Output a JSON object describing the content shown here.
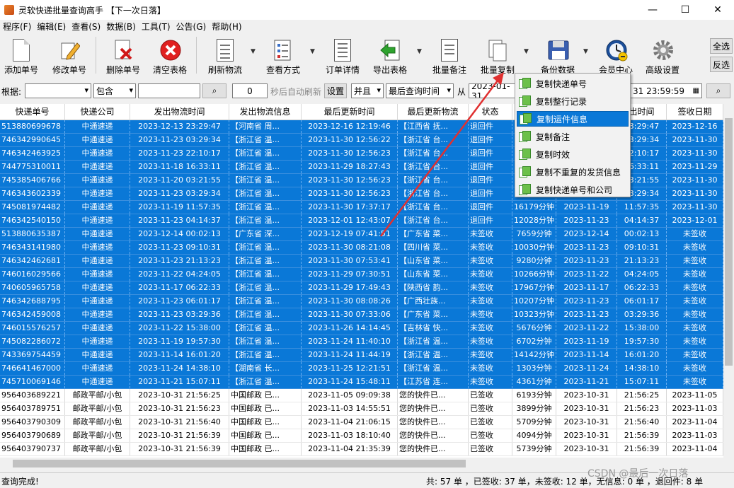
{
  "window": {
    "title": "灵软快递批量查询高手 【下一次日落】",
    "minimize": "—",
    "maximize": "☐",
    "close": "✕"
  },
  "menu": [
    "程序(F)",
    "编辑(E)",
    "查看(S)",
    "数据(B)",
    "工具(T)",
    "公告(G)",
    "帮助(H)"
  ],
  "toolbar": {
    "add": "添加单号",
    "edit": "修改单号",
    "delete": "删除单号",
    "clear": "清空表格",
    "refresh": "刷新物流",
    "view": "查看方式",
    "detail": "订单详情",
    "export": "导出表格",
    "note": "批量备注",
    "copy": "批量复制",
    "backup": "备份数据",
    "member": "会员中心",
    "advanced": "高级设置",
    "select_all": "全选",
    "invert": "反选"
  },
  "filter": {
    "label_basis": "根据:",
    "basis_value": "",
    "match": "包含",
    "keyword": "",
    "seconds": "0",
    "auto_refresh": "秒后自动刷新",
    "set": "设置",
    "and": "并且",
    "field": "最后查询时间",
    "from": "从",
    "date_from": "2023-01-31",
    "date_to_tail": "31 23:59:59"
  },
  "columns": [
    "快递单号",
    "快递公司",
    "发出物流时间",
    "发出物流信息",
    "最后更新时间",
    "最后更新物流",
    "状态",
    "",
    "",
    "出时间",
    "签收日期"
  ],
  "rows": [
    [
      "513880699678",
      "中通速递",
      "2023-12-13 23:29:47",
      "【河南省 周...",
      "2023-12-16 12:19:46",
      "【江西省 抚...",
      "退回件",
      "3",
      "",
      "23:29:47",
      "2023-12-16",
      true
    ],
    [
      "746342990645",
      "中通速递",
      "2023-11-23 03:29:34",
      "【浙江省 温...",
      "2023-11-30 12:56:22",
      "【浙江省 台...",
      "退回件",
      "",
      "",
      "03:29:34",
      "2023-11-30",
      true
    ],
    [
      "746342463925",
      "中通速递",
      "2023-11-23 22:10:17",
      "【浙江省 温...",
      "2023-11-30 12:56:23",
      "【浙江省 台...",
      "退回件",
      "",
      "",
      "22:10:17",
      "2023-11-30",
      true
    ],
    [
      "744775310011",
      "中通速递",
      "2023-11-18 16:33:11",
      "【浙江省 温...",
      "2023-11-29 18:27:43",
      "【浙江省 台...",
      "退回件",
      "",
      "",
      "16:33:11",
      "2023-11-29",
      true
    ],
    [
      "745385406766",
      "中通速递",
      "2023-11-20 03:21:55",
      "【浙江省 温...",
      "2023-11-30 12:56:23",
      "【浙江省 台...",
      "退回件",
      "",
      "",
      "03:21:55",
      "2023-11-30",
      true
    ],
    [
      "746343602339",
      "中通速递",
      "2023-11-23 03:29:34",
      "【浙江省 温...",
      "2023-11-30 12:56:23",
      "【浙江省 台...",
      "退回件",
      "",
      "",
      "03:29:34",
      "2023-11-30",
      true
    ],
    [
      "745081974482",
      "中通速递",
      "2023-11-19 11:57:35",
      "【浙江省 温...",
      "2023-11-30 17:37:17",
      "【浙江省 台...",
      "退回件",
      "16179分钟",
      "2023-11-19",
      "11:57:35",
      "2023-11-30",
      true
    ],
    [
      "746342540150",
      "中通速递",
      "2023-11-23 04:14:37",
      "【浙江省 温...",
      "2023-12-01 12:43:07",
      "【浙江省 台...",
      "退回件",
      "12028分钟",
      "2023-11-23",
      "04:14:37",
      "2023-12-01",
      true
    ],
    [
      "513880635387",
      "中通速递",
      "2023-12-14 00:02:13",
      "【广东省 深...",
      "2023-12-19 07:41:51",
      "【广东省 菜...",
      "未签收",
      "7659分钟",
      "2023-12-14",
      "00:02:13",
      "未签收",
      true
    ],
    [
      "746343141980",
      "中通速递",
      "2023-11-23 09:10:31",
      "【浙江省 温...",
      "2023-11-30 08:21:08",
      "【四川省 菜...",
      "未签收",
      "10030分钟",
      "2023-11-23",
      "09:10:31",
      "未签收",
      true
    ],
    [
      "746342462681",
      "中通速递",
      "2023-11-23 21:13:23",
      "【浙江省 温...",
      "2023-11-30 07:53:41",
      "【山东省 菜...",
      "未签收",
      "9280分钟",
      "2023-11-23",
      "21:13:23",
      "未签收",
      true
    ],
    [
      "746016029566",
      "中通速递",
      "2023-11-22 04:24:05",
      "【浙江省 温...",
      "2023-11-29 07:30:51",
      "【山东省 菜...",
      "未签收",
      "10266分钟",
      "2023-11-22",
      "04:24:05",
      "未签收",
      true
    ],
    [
      "740605965758",
      "中通速递",
      "2023-11-17 06:22:33",
      "【浙江省 温...",
      "2023-11-29 17:49:43",
      "【陕西省 韵...",
      "未签收",
      "17967分钟",
      "2023-11-17",
      "06:22:33",
      "未签收",
      true
    ],
    [
      "746342688795",
      "中通速递",
      "2023-11-23 06:01:17",
      "【浙江省 温...",
      "2023-11-30 08:08:26",
      "【广西壮族...",
      "未签收",
      "10207分钟",
      "2023-11-23",
      "06:01:17",
      "未签收",
      true
    ],
    [
      "746342459008",
      "中通速递",
      "2023-11-23 03:29:36",
      "【浙江省 温...",
      "2023-11-30 07:33:06",
      "【广东省 菜...",
      "未签收",
      "10323分钟",
      "2023-11-23",
      "03:29:36",
      "未签收",
      true
    ],
    [
      "746015576257",
      "中通速递",
      "2023-11-22 15:38:00",
      "【浙江省 温...",
      "2023-11-26 14:14:45",
      "【吉林省 快...",
      "未签收",
      "5676分钟",
      "2023-11-22",
      "15:38:00",
      "未签收",
      true
    ],
    [
      "745082286072",
      "中通速递",
      "2023-11-19 19:57:30",
      "【浙江省 温...",
      "2023-11-24 11:40:10",
      "【浙江省 温...",
      "未签收",
      "6702分钟",
      "2023-11-19",
      "19:57:30",
      "未签收",
      true
    ],
    [
      "743369754459",
      "中通速递",
      "2023-11-14 16:01:20",
      "【浙江省 温...",
      "2023-11-24 11:44:19",
      "【浙江省 温...",
      "未签收",
      "14142分钟",
      "2023-11-14",
      "16:01:20",
      "未签收",
      true
    ],
    [
      "746641467000",
      "中通速递",
      "2023-11-24 14:38:10",
      "【湖南省 长...",
      "2023-11-25 12:21:51",
      "【浙江省 温...",
      "未签收",
      "1303分钟",
      "2023-11-24",
      "14:38:10",
      "未签收",
      true
    ],
    [
      "745710069146",
      "中通速递",
      "2023-11-21 15:07:11",
      "【浙江省 温...",
      "2023-11-24 15:48:11",
      "【江苏省 连...",
      "未签收",
      "4361分钟",
      "2023-11-21",
      "15:07:11",
      "未签收",
      true
    ],
    [
      "956403689221",
      "邮政平邮/小包",
      "2023-10-31 21:56:25",
      "中国邮政 已...",
      "2023-11-05 09:09:38",
      "您的快件已...",
      "已签收",
      "6193分钟",
      "2023-10-31",
      "21:56:25",
      "2023-11-05",
      false
    ],
    [
      "956403789751",
      "邮政平邮/小包",
      "2023-10-31 21:56:23",
      "中国邮政 已...",
      "2023-11-03 14:55:51",
      "您的快件已...",
      "已签收",
      "3899分钟",
      "2023-10-31",
      "21:56:23",
      "2023-11-03",
      false
    ],
    [
      "956403790309",
      "邮政平邮/小包",
      "2023-10-31 21:56:40",
      "中国邮政 已...",
      "2023-11-04 21:06:15",
      "您的快件已...",
      "已签收",
      "5709分钟",
      "2023-10-31",
      "21:56:40",
      "2023-11-04",
      false
    ],
    [
      "956403790689",
      "邮政平邮/小包",
      "2023-10-31 21:56:39",
      "中国邮政 已...",
      "2023-11-03 18:10:40",
      "您的快件已...",
      "已签收",
      "4094分钟",
      "2023-10-31",
      "21:56:39",
      "2023-11-03",
      false
    ],
    [
      "956403790737",
      "邮政平邮/小包",
      "2023-10-31 21:56:39",
      "中国邮政 已...",
      "2023-11-04 21:35:39",
      "您的快件已...",
      "已签收",
      "5739分钟",
      "2023-10-31",
      "21:56:39",
      "2023-11-04",
      false
    ]
  ],
  "context_menu": [
    "复制快递单号",
    "复制整行记录",
    "复制运件信息",
    "复制备注",
    "复制时效",
    "复制不重复的发货信息",
    "复制快递单号和公司"
  ],
  "status": {
    "left": "查询完成!",
    "right": "共: 57 单 ，已签收: 37 单，未签收: 12 单，无信息: 0 单 ，退回件: 8 单"
  },
  "watermark": "CSDN @最后一次日落"
}
